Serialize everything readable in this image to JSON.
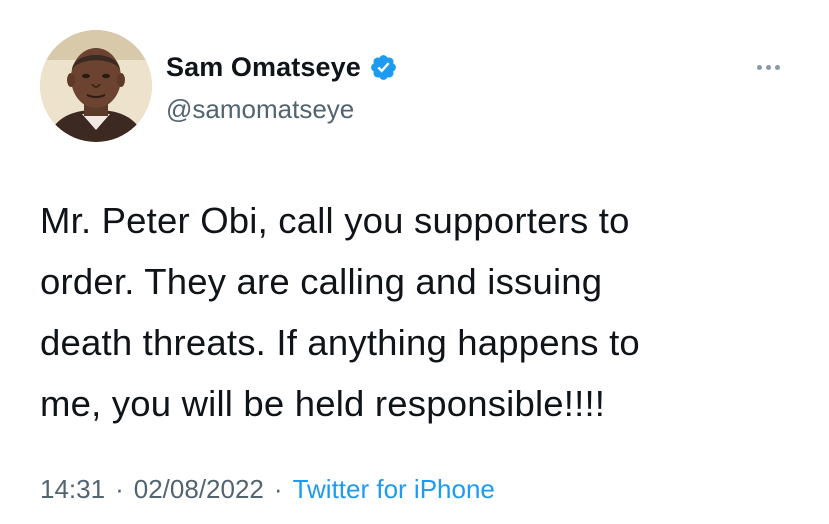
{
  "author": {
    "name": "Sam Omatseye",
    "handle": "@samomatseye",
    "verified": true,
    "avatar_icon": "profile-photo"
  },
  "more_icon": "more-options-icon",
  "tweet": {
    "lines": [
      "Mr. Peter Obi, call you supporters to",
      "order. They are calling and issuing",
      "death threats. If anything happens to",
      "me, you will be held responsible!!!!"
    ]
  },
  "meta": {
    "time": "14:31",
    "separator": "·",
    "date": "02/08/2022",
    "source": "Twitter for iPhone"
  },
  "colors": {
    "text": "#0f1419",
    "secondary": "#536471",
    "link": "#1d9bf0",
    "verified": "#1d9bf0"
  }
}
